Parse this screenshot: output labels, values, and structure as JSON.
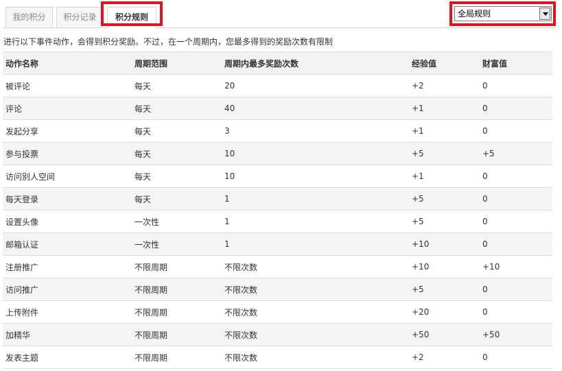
{
  "tabs": [
    {
      "label": "我的积分"
    },
    {
      "label": "积分记录"
    },
    {
      "label": "积分规则"
    }
  ],
  "filter": {
    "selected": "全局规则"
  },
  "description": "进行以下事件动作，会得到积分奖励。不过，在一个周期内，您最多得到的奖励次数有限制",
  "table": {
    "headers": [
      "动作名称",
      "周期范围",
      "周期内最多奖励次数",
      "经验值",
      "财富值"
    ],
    "rows": [
      [
        "被评论",
        "每天",
        "20",
        "+2",
        "0"
      ],
      [
        "评论",
        "每天",
        "40",
        "+1",
        "0"
      ],
      [
        "发起分享",
        "每天",
        "3",
        "+1",
        "0"
      ],
      [
        "参与投票",
        "每天",
        "10",
        "+5",
        "+5"
      ],
      [
        "访问别人空间",
        "每天",
        "10",
        "+1",
        "0"
      ],
      [
        "每天登录",
        "每天",
        "1",
        "+5",
        "0"
      ],
      [
        "设置头像",
        "一次性",
        "1",
        "+5",
        "0"
      ],
      [
        "邮箱认证",
        "一次性",
        "1",
        "+10",
        "0"
      ],
      [
        "注册推广",
        "不限周期",
        "不限次数",
        "+10",
        "+10"
      ],
      [
        "访问推广",
        "不限周期",
        "不限次数",
        "+5",
        "0"
      ],
      [
        "上传附件",
        "不限周期",
        "不限次数",
        "+20",
        "0"
      ],
      [
        "加精华",
        "不限周期",
        "不限次数",
        "+50",
        "+50"
      ],
      [
        "发表主题",
        "不限周期",
        "不限次数",
        "+2",
        "0"
      ]
    ]
  },
  "colors": {
    "highlight": "#e3131d"
  }
}
